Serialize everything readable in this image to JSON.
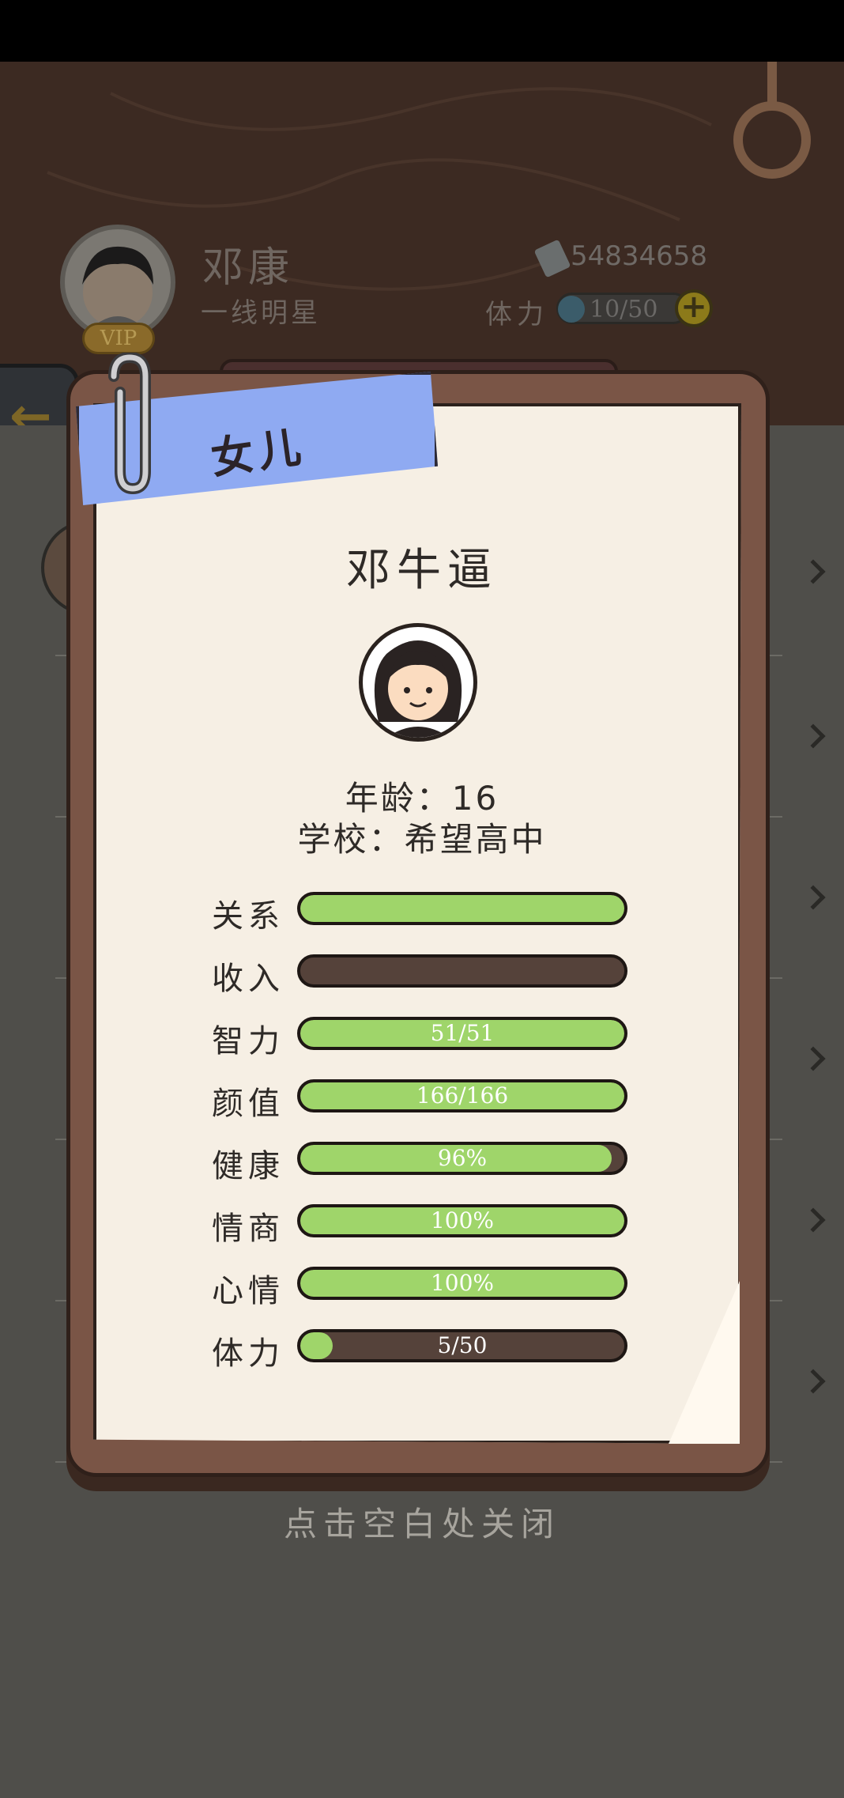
{
  "player": {
    "name": "邓康",
    "title": "一线明星",
    "vip": "VIP",
    "money": "54834658",
    "stamina_label": "体力",
    "stamina_value": "10/50"
  },
  "dialog": {
    "ribbon_title": "女儿",
    "child_name": "邓牛逼",
    "age": "年龄：16",
    "school": "学校：希望高中",
    "stats": [
      {
        "label": "关系",
        "text": "",
        "fill": 1.0
      },
      {
        "label": "收入",
        "text": "",
        "fill": 0.0
      },
      {
        "label": "智力",
        "text": "51/51",
        "fill": 1.0
      },
      {
        "label": "颜值",
        "text": "166/166",
        "fill": 1.0
      },
      {
        "label": "健康",
        "text": "96%",
        "fill": 0.96
      },
      {
        "label": "情商",
        "text": "100%",
        "fill": 1.0
      },
      {
        "label": "心情",
        "text": "100%",
        "fill": 1.0
      },
      {
        "label": "体力",
        "text": "5/50",
        "fill": 0.1
      }
    ]
  },
  "close_hint": "点击空白处关闭",
  "colors": {
    "bar_fill": "#9fd56a",
    "bar_empty": "#55423a",
    "ribbon": "#8faaf2",
    "paper": "#f6efe4",
    "frame": "#7a5546"
  }
}
